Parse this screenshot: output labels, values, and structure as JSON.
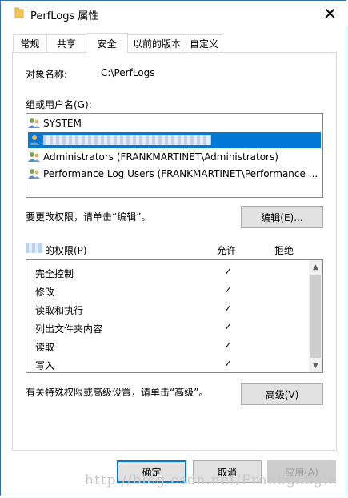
{
  "window": {
    "title": "PerfLogs 属性",
    "close_icon": "close-icon",
    "folder_icon": "folder-icon"
  },
  "tabs": [
    {
      "label": "常规"
    },
    {
      "label": "共享"
    },
    {
      "label": "安全",
      "active": true
    },
    {
      "label": "以前的版本"
    },
    {
      "label": "自定义"
    }
  ],
  "object": {
    "label": "对象名称:",
    "value": "C:\\PerfLogs"
  },
  "groups": {
    "label": "组或用户名(G):",
    "items": [
      {
        "name": "SYSTEM"
      },
      {
        "name": ""
      },
      {
        "name": "Administrators (FRANKMARTINET\\Administrators)"
      },
      {
        "name": "Performance Log Users (FRANKMARTINET\\Performance ..."
      }
    ],
    "selected_index": 1
  },
  "edit_hint": "要更改权限，请单击“编辑”。",
  "edit_button": "编辑(E)...",
  "permissions": {
    "header_label": "的权限(P)",
    "allow_header": "允许",
    "deny_header": "拒绝",
    "rows": [
      {
        "name": "完全控制",
        "allow": "✓",
        "deny": ""
      },
      {
        "name": "修改",
        "allow": "✓",
        "deny": ""
      },
      {
        "name": "读取和执行",
        "allow": "✓",
        "deny": ""
      },
      {
        "name": "列出文件夹内容",
        "allow": "✓",
        "deny": ""
      },
      {
        "name": "读取",
        "allow": "✓",
        "deny": ""
      },
      {
        "name": "写入",
        "allow": "✓",
        "deny": ""
      }
    ]
  },
  "advanced_hint": "有关特殊权限或高级设置，请单击“高级”。",
  "advanced_button": "高级(V)",
  "footer": {
    "ok": "确定",
    "cancel": "取消",
    "apply": "应用(A)"
  },
  "watermark": "http://blog.csdn.net/Frankgoogle",
  "colors": {
    "selection": "#0078d7",
    "border": "#828790"
  }
}
